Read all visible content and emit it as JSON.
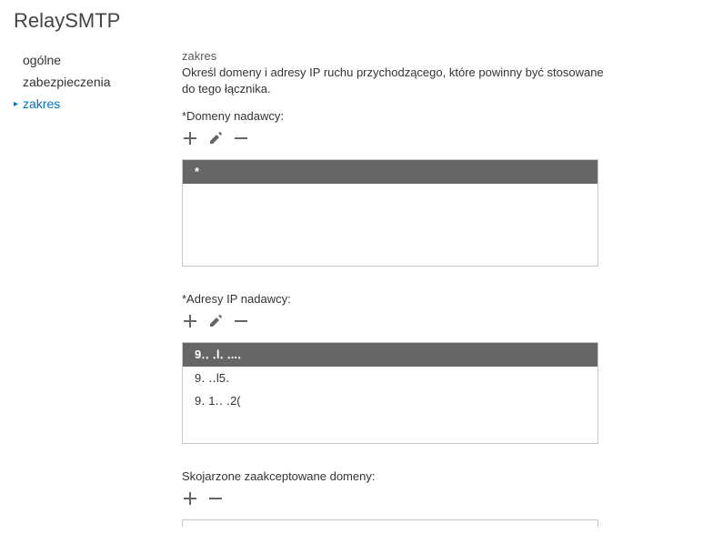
{
  "page_title": "RelaySMTP",
  "sidebar": {
    "items": [
      {
        "label": "ogólne",
        "selected": false
      },
      {
        "label": "zabezpieczenia",
        "selected": false
      },
      {
        "label": "zakres",
        "selected": true
      }
    ]
  },
  "main": {
    "section_heading": "zakres",
    "section_desc": "Określ domeny i adresy IP ruchu przychodzącego, które powinny być stosowane do tego łącznika.",
    "domains": {
      "label": "*Domeny nadawcy:",
      "items": [
        {
          "value": "*",
          "selected": true
        }
      ]
    },
    "ips": {
      "label": "*Adresy IP nadawcy:",
      "items": [
        {
          "value": "9․․ ․l․  ․..․",
          "selected": true
        },
        {
          "value": "9․  ․․l5․",
          "selected": false
        },
        {
          "value": "9․   1․․  ․2(",
          "selected": false
        }
      ]
    },
    "associated": {
      "label": "Skojarzone zaakceptowane domeny:"
    }
  }
}
